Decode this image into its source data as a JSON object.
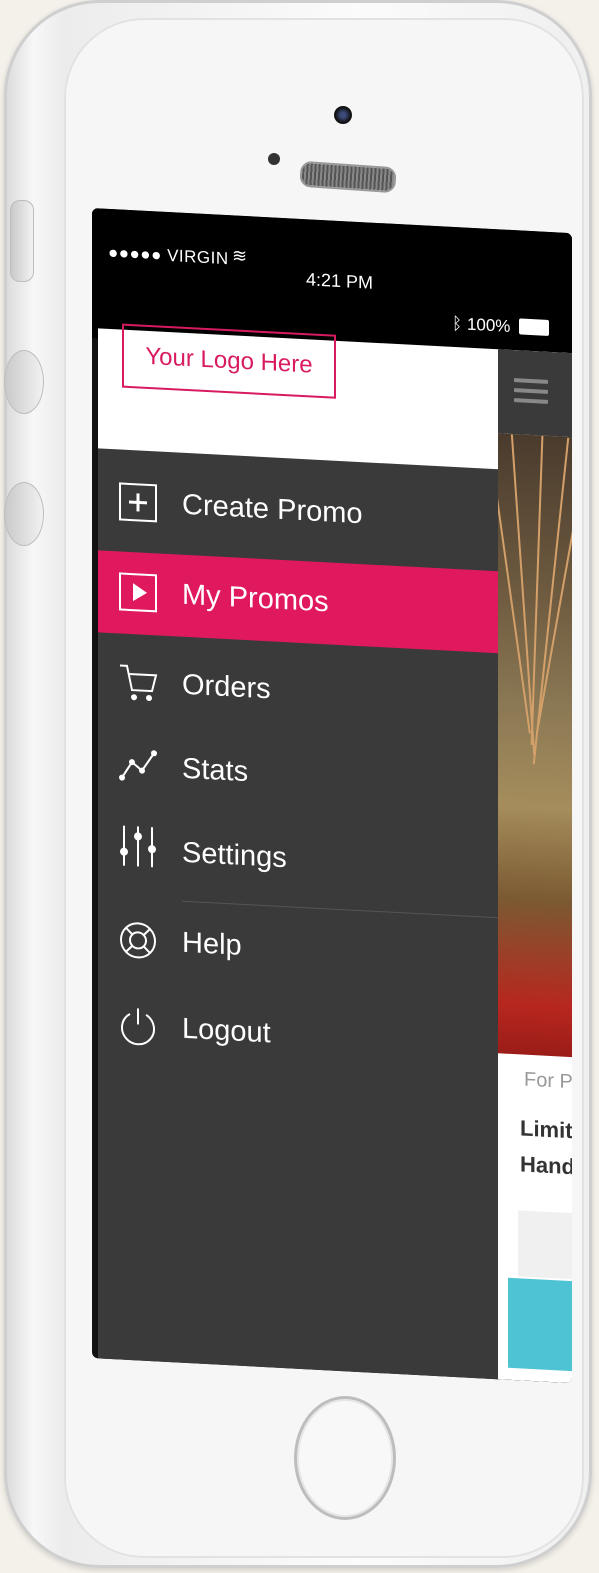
{
  "status_bar": {
    "carrier": "●●●●● VIRGIN",
    "time": "4:21 PM",
    "battery": "100%"
  },
  "logo": {
    "text": "Your Logo Here"
  },
  "menu": [
    {
      "label": "Create Promo",
      "icon": "plus-square-icon",
      "active": false
    },
    {
      "label": "My Promos",
      "icon": "play-square-icon",
      "active": true
    },
    {
      "label": "Orders",
      "icon": "cart-icon",
      "active": false
    },
    {
      "label": "Stats",
      "icon": "line-chart-icon",
      "active": false
    },
    {
      "label": "Settings",
      "icon": "sliders-icon",
      "active": false
    },
    {
      "label": "Help",
      "icon": "lifebuoy-icon",
      "active": false
    },
    {
      "label": "Logout",
      "icon": "power-icon",
      "active": false
    }
  ],
  "content_peek": {
    "subtitle": "For P",
    "title_line1": "Limit",
    "title_line2": "Hand"
  },
  "colors": {
    "accent": "#e0195f",
    "drawer_bg": "#3a3a3a",
    "cta": "#4ec3d4"
  }
}
